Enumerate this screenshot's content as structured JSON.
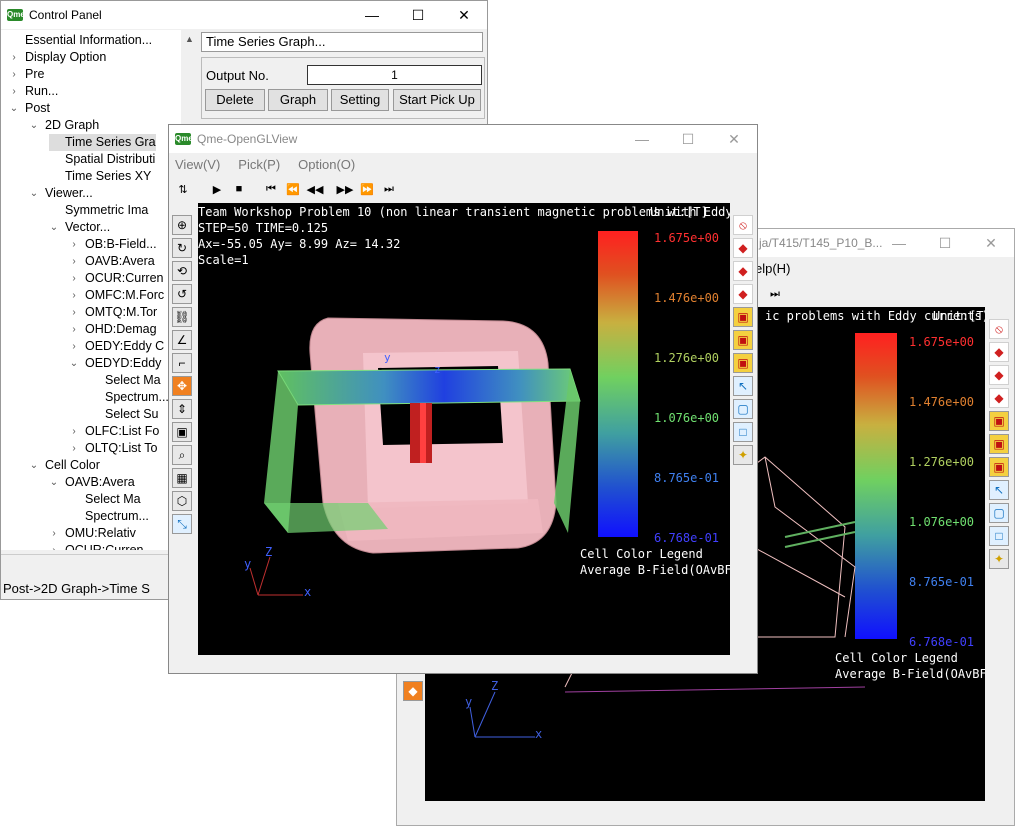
{
  "control_panel": {
    "title": "Control Panel",
    "window_buttons": {
      "min": "—",
      "max": "☐",
      "close": "✕"
    },
    "tree": [
      {
        "label": "Essential Information...",
        "indent": 0,
        "arrow": ""
      },
      {
        "label": "Display Option",
        "indent": 0,
        "arrow": ">"
      },
      {
        "label": "Pre",
        "indent": 0,
        "arrow": ">"
      },
      {
        "label": "Run...",
        "indent": 0,
        "arrow": ">"
      },
      {
        "label": "Post",
        "indent": 0,
        "arrow": "v"
      },
      {
        "label": "2D Graph",
        "indent": 1,
        "arrow": "v"
      },
      {
        "label": "Time Series Gra",
        "indent": 2,
        "arrow": "",
        "selected": true
      },
      {
        "label": "Spatial Distributi",
        "indent": 2,
        "arrow": ""
      },
      {
        "label": "Time Series XY",
        "indent": 2,
        "arrow": ""
      },
      {
        "label": "Viewer...",
        "indent": 1,
        "arrow": "v"
      },
      {
        "label": "Symmetric Ima",
        "indent": 2,
        "arrow": ""
      },
      {
        "label": "Vector...",
        "indent": 2,
        "arrow": "v"
      },
      {
        "label": "OB:B-Field...",
        "indent": 3,
        "arrow": ">"
      },
      {
        "label": "OAVB:Avera",
        "indent": 3,
        "arrow": ">"
      },
      {
        "label": "OCUR:Curren",
        "indent": 3,
        "arrow": ">"
      },
      {
        "label": "OMFC:M.Forc",
        "indent": 3,
        "arrow": ">"
      },
      {
        "label": "OMTQ:M.Tor",
        "indent": 3,
        "arrow": ">"
      },
      {
        "label": "OHD:Demag",
        "indent": 3,
        "arrow": ">"
      },
      {
        "label": "OEDY:Eddy C",
        "indent": 3,
        "arrow": ">"
      },
      {
        "label": "OEDYD:Eddy",
        "indent": 3,
        "arrow": "v"
      },
      {
        "label": "Select Ma",
        "indent": 4,
        "arrow": ""
      },
      {
        "label": "Spectrum...",
        "indent": 4,
        "arrow": ""
      },
      {
        "label": "Select Su",
        "indent": 4,
        "arrow": ""
      },
      {
        "label": "OLFC:List Fo",
        "indent": 3,
        "arrow": ">"
      },
      {
        "label": "OLTQ:List To",
        "indent": 3,
        "arrow": ">"
      },
      {
        "label": "Cell Color",
        "indent": 1,
        "arrow": "v"
      },
      {
        "label": "OAVB:Avera",
        "indent": 2,
        "arrow": "v"
      },
      {
        "label": "Select Ma",
        "indent": 3,
        "arrow": ""
      },
      {
        "label": "Spectrum...",
        "indent": 3,
        "arrow": ""
      },
      {
        "label": "OMU:Relativ",
        "indent": 2,
        "arrow": ">"
      },
      {
        "label": "OCUR:Curren",
        "indent": 2,
        "arrow": ">"
      }
    ],
    "panel_title": "Time Series Graph...",
    "output_label": "Output No.",
    "output_value": "1",
    "buttons": [
      "Delete",
      "Graph",
      "Setting",
      "Start Pick Up"
    ],
    "status": "Post->2D Graph->Time S"
  },
  "viewer_front": {
    "title": "Qme-OpenGLView",
    "menus": [
      "View(V)",
      "Pick(P)",
      "Option(O)"
    ],
    "toolbar_glyphs": [
      "⇅",
      "▶",
      "■",
      "⏮",
      "⏪",
      "◀◀",
      "▶▶",
      "⏩",
      "⏭"
    ],
    "info": [
      "Team Workshop Problem 10 (non linear transient magnetic problems with Eddy currents)",
      "STEP=50  TIME=0.125",
      "Ax=-55.05 Ay=  8.99 Az= 14.32",
      "Scale=1"
    ],
    "unit": "Unit:[T]",
    "legend_ticks": [
      {
        "value": "1.675e+00",
        "color": "#ff3030"
      },
      {
        "value": "1.476e+00",
        "color": "#e08030"
      },
      {
        "value": "1.276e+00",
        "color": "#b0d060"
      },
      {
        "value": "1.076e+00",
        "color": "#70e070"
      },
      {
        "value": "8.765e-01",
        "color": "#4080f0"
      },
      {
        "value": "6.768e-01",
        "color": "#4040ff"
      }
    ],
    "legend_title": "Cell Color Legend",
    "legend_subtitle": "Average B-Field(OAvBFiel",
    "axis_labels": {
      "x": "x",
      "y": "y",
      "z": "Z"
    }
  },
  "viewer_back": {
    "title": "ja/T415/T145_P10_B...",
    "menu": "elp(H)",
    "info": "ic problems with Eddy currents)",
    "unit": "Unit:[T]",
    "legend_ticks": [
      {
        "value": "1.675e+00",
        "color": "#ff3030"
      },
      {
        "value": "1.476e+00",
        "color": "#e08030"
      },
      {
        "value": "1.276e+00",
        "color": "#b0d060"
      },
      {
        "value": "1.076e+00",
        "color": "#70e070"
      },
      {
        "value": "8.765e-01",
        "color": "#4080f0"
      },
      {
        "value": "6.768e-01",
        "color": "#4040ff"
      }
    ],
    "legend_title": "Cell Color Legend",
    "legend_subtitle": "Average B-Field(OAvBField",
    "axis_labels": {
      "x": "x",
      "y": "y",
      "z": "Z"
    }
  }
}
